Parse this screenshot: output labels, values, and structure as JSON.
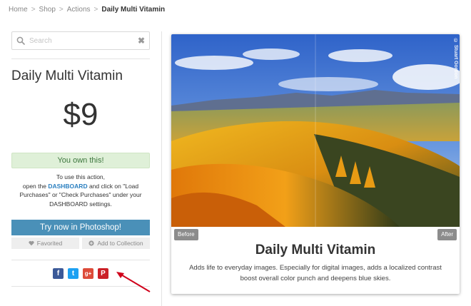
{
  "breadcrumb": {
    "items": [
      "Home",
      "Shop",
      "Actions"
    ],
    "current": "Daily Multi Vitamin",
    "separator": ">"
  },
  "search": {
    "placeholder": "Search",
    "clear": "✖"
  },
  "product": {
    "title": "Daily Multi Vitamin",
    "price": "$9",
    "owned_message": "You own this!",
    "instructions": {
      "line1": "To use this action,",
      "part1": "open the",
      "link": "DASHBOARD",
      "part2": "and click on \"Load Purchases\" or \"Check Purchases\" under your DASHBOARD settings."
    }
  },
  "buttons": {
    "try": "Try now in Photoshop!",
    "favorited": "Favorited",
    "add_collection": "Add to Collection"
  },
  "social": {
    "facebook": "f",
    "twitter": "t",
    "googleplus": "g+",
    "pinterest": "P"
  },
  "preview": {
    "before_label": "Before",
    "after_label": "After",
    "watermark": "© Stuart Gordon",
    "title": "Daily Multi Vitamin",
    "description": "Adds life to everyday images. Especially for digital images, adds a localized contrast boost overall color punch and deepens blue skies."
  },
  "colors": {
    "accent": "#4a90b8",
    "link": "#2a7fc0",
    "owned_bg": "#dff0d8",
    "owned_text": "#3c763d",
    "arrow": "#d0021b"
  }
}
